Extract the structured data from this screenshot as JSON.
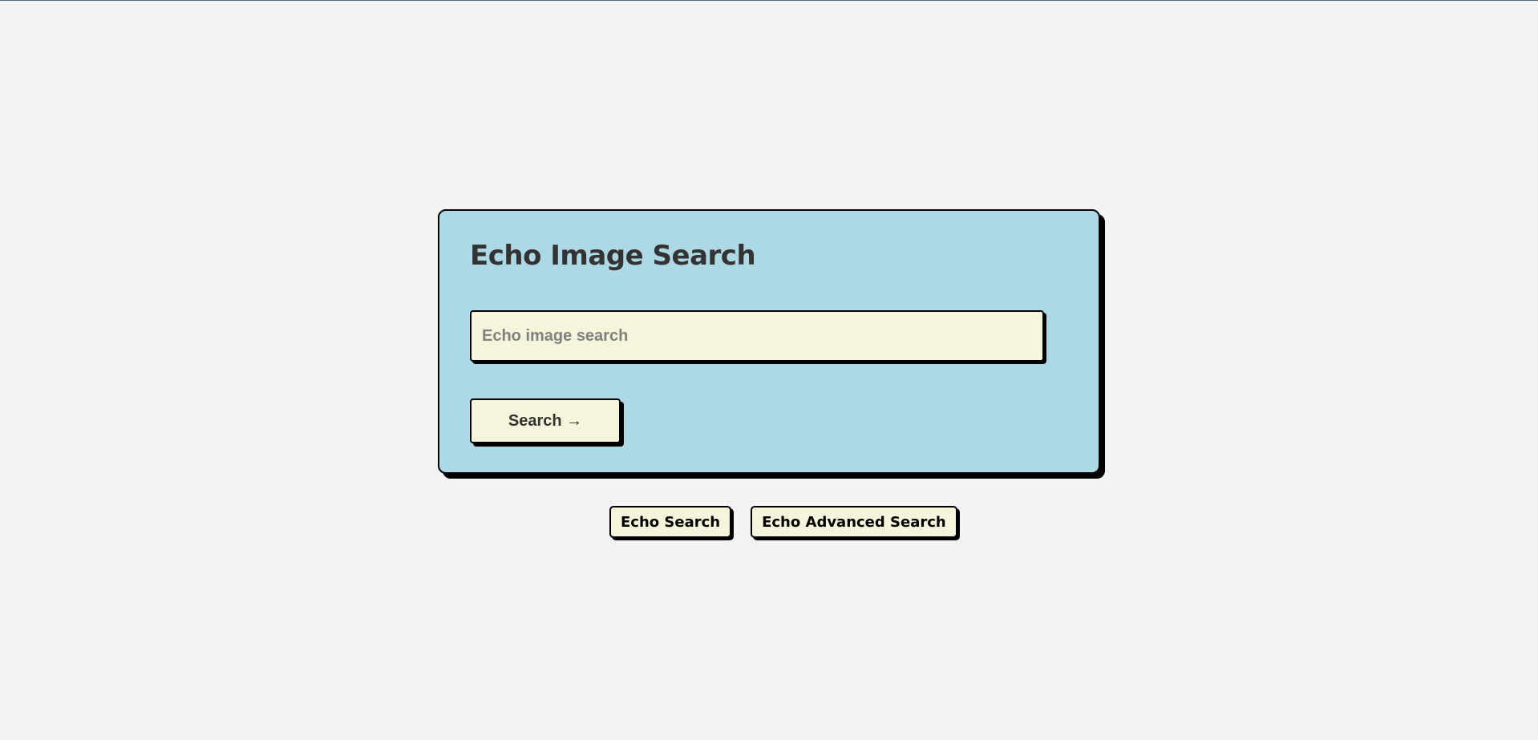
{
  "card": {
    "title": "Echo Image Search",
    "search": {
      "placeholder": "Echo image search",
      "value": ""
    },
    "submit_label": "Search →"
  },
  "footer": {
    "links": [
      {
        "label": "Echo Search"
      },
      {
        "label": "Echo Advanced Search"
      }
    ]
  },
  "colors": {
    "page_background": "#f3f3f3",
    "card_background": "#add8e6",
    "control_background": "#f5f5dc",
    "border": "#000000",
    "text": "#333333",
    "placeholder": "#808080"
  }
}
